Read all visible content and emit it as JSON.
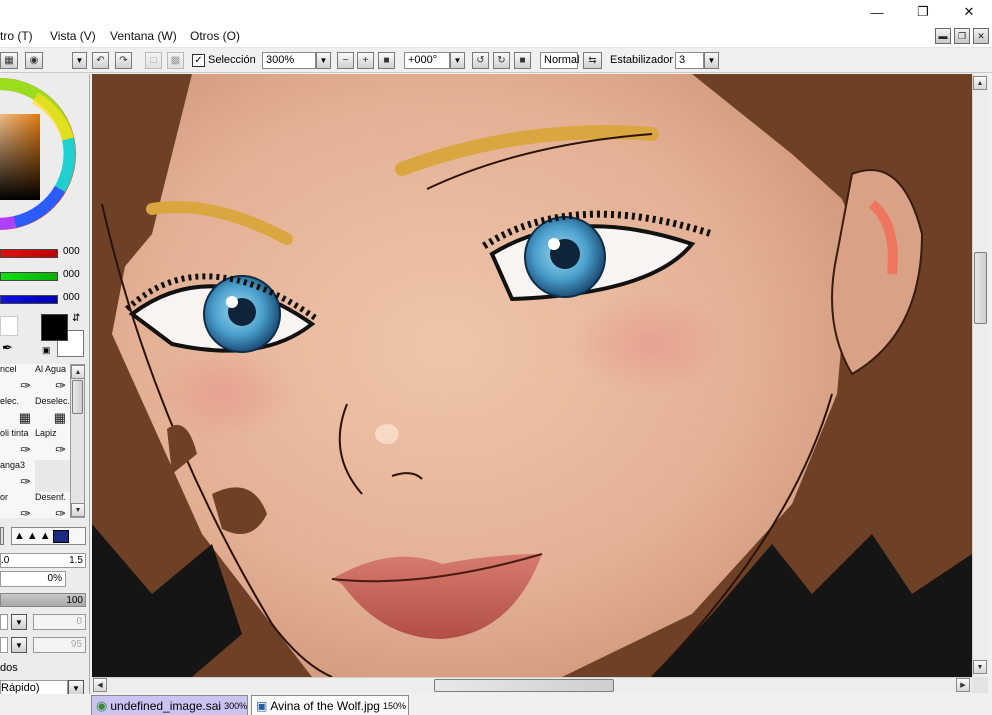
{
  "window": {
    "min_icon": "minimize-icon",
    "max_icon": "restore-icon",
    "close_icon": "close-icon"
  },
  "menu": {
    "items": [
      "tro (T)",
      "Vista (V)",
      "Ventana (W)",
      "Otros (O)"
    ]
  },
  "toolbar": {
    "selection_label": "Selección",
    "selection_checked": true,
    "zoom_value": "300%",
    "rotation_value": "+000°",
    "blend_mode": "Normal",
    "stabilizer_label": "Estabilizador",
    "stabilizer_value": "3"
  },
  "color_panel": {
    "red_value": "000",
    "green_value": "000",
    "blue_value": "000",
    "foreground_color": "#000000",
    "background_color": "#ffffff"
  },
  "tools": {
    "items": [
      {
        "label": "ncel",
        "icon": "pen-icon"
      },
      {
        "label": "Al Agua",
        "icon": "water-brush-icon"
      },
      {
        "label": "elec.",
        "icon": "select-icon"
      },
      {
        "label": "Deselec.",
        "icon": "deselect-icon"
      },
      {
        "label": "oli tinta",
        "icon": "ink-pen-icon"
      },
      {
        "label": "Lapiz",
        "icon": "pencil-icon"
      },
      {
        "label": "anga3",
        "icon": "manga-pen-icon"
      },
      {
        "label": "",
        "icon": ""
      },
      {
        "label": "or",
        "icon": "eraser-icon"
      },
      {
        "label": "Desenf.",
        "icon": "blur-icon"
      }
    ]
  },
  "brush_settings": {
    "size_min": ".0",
    "size_max": "1.5",
    "density_value": "0%",
    "opacity_value": "100",
    "field_a": "0",
    "field_b": "95",
    "mode_label": "dos",
    "quality_value": "Rápido)",
    "last_value": "0"
  },
  "tabs": [
    {
      "name": "undefined_image.sai",
      "zoom": "300%",
      "active": true
    },
    {
      "name": "Avina of the Wolf.jpg",
      "zoom": "150%",
      "active": false
    }
  ]
}
